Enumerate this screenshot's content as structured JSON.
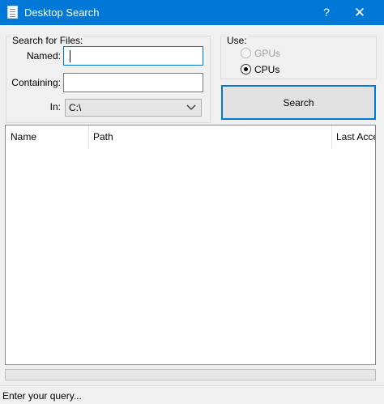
{
  "window": {
    "title": "Desktop Search",
    "help_label": "?",
    "close_label": "✕",
    "accent_color": "#0078d7"
  },
  "search_group": {
    "legend": "Search for Files:",
    "named_label": "Named:",
    "named_value": "",
    "containing_label": "Containing:",
    "containing_value": "",
    "in_label": "In:",
    "in_value": "C:\\"
  },
  "use_group": {
    "legend": "Use:",
    "options": [
      {
        "label": "GPUs",
        "selected": false,
        "enabled": false
      },
      {
        "label": "CPUs",
        "selected": true,
        "enabled": true
      }
    ]
  },
  "search_button": {
    "label": "Search"
  },
  "results": {
    "columns": [
      "Name",
      "Path",
      "Last Acce"
    ],
    "rows": []
  },
  "progress": {
    "value": 0
  },
  "status": {
    "text": "Enter your query..."
  }
}
